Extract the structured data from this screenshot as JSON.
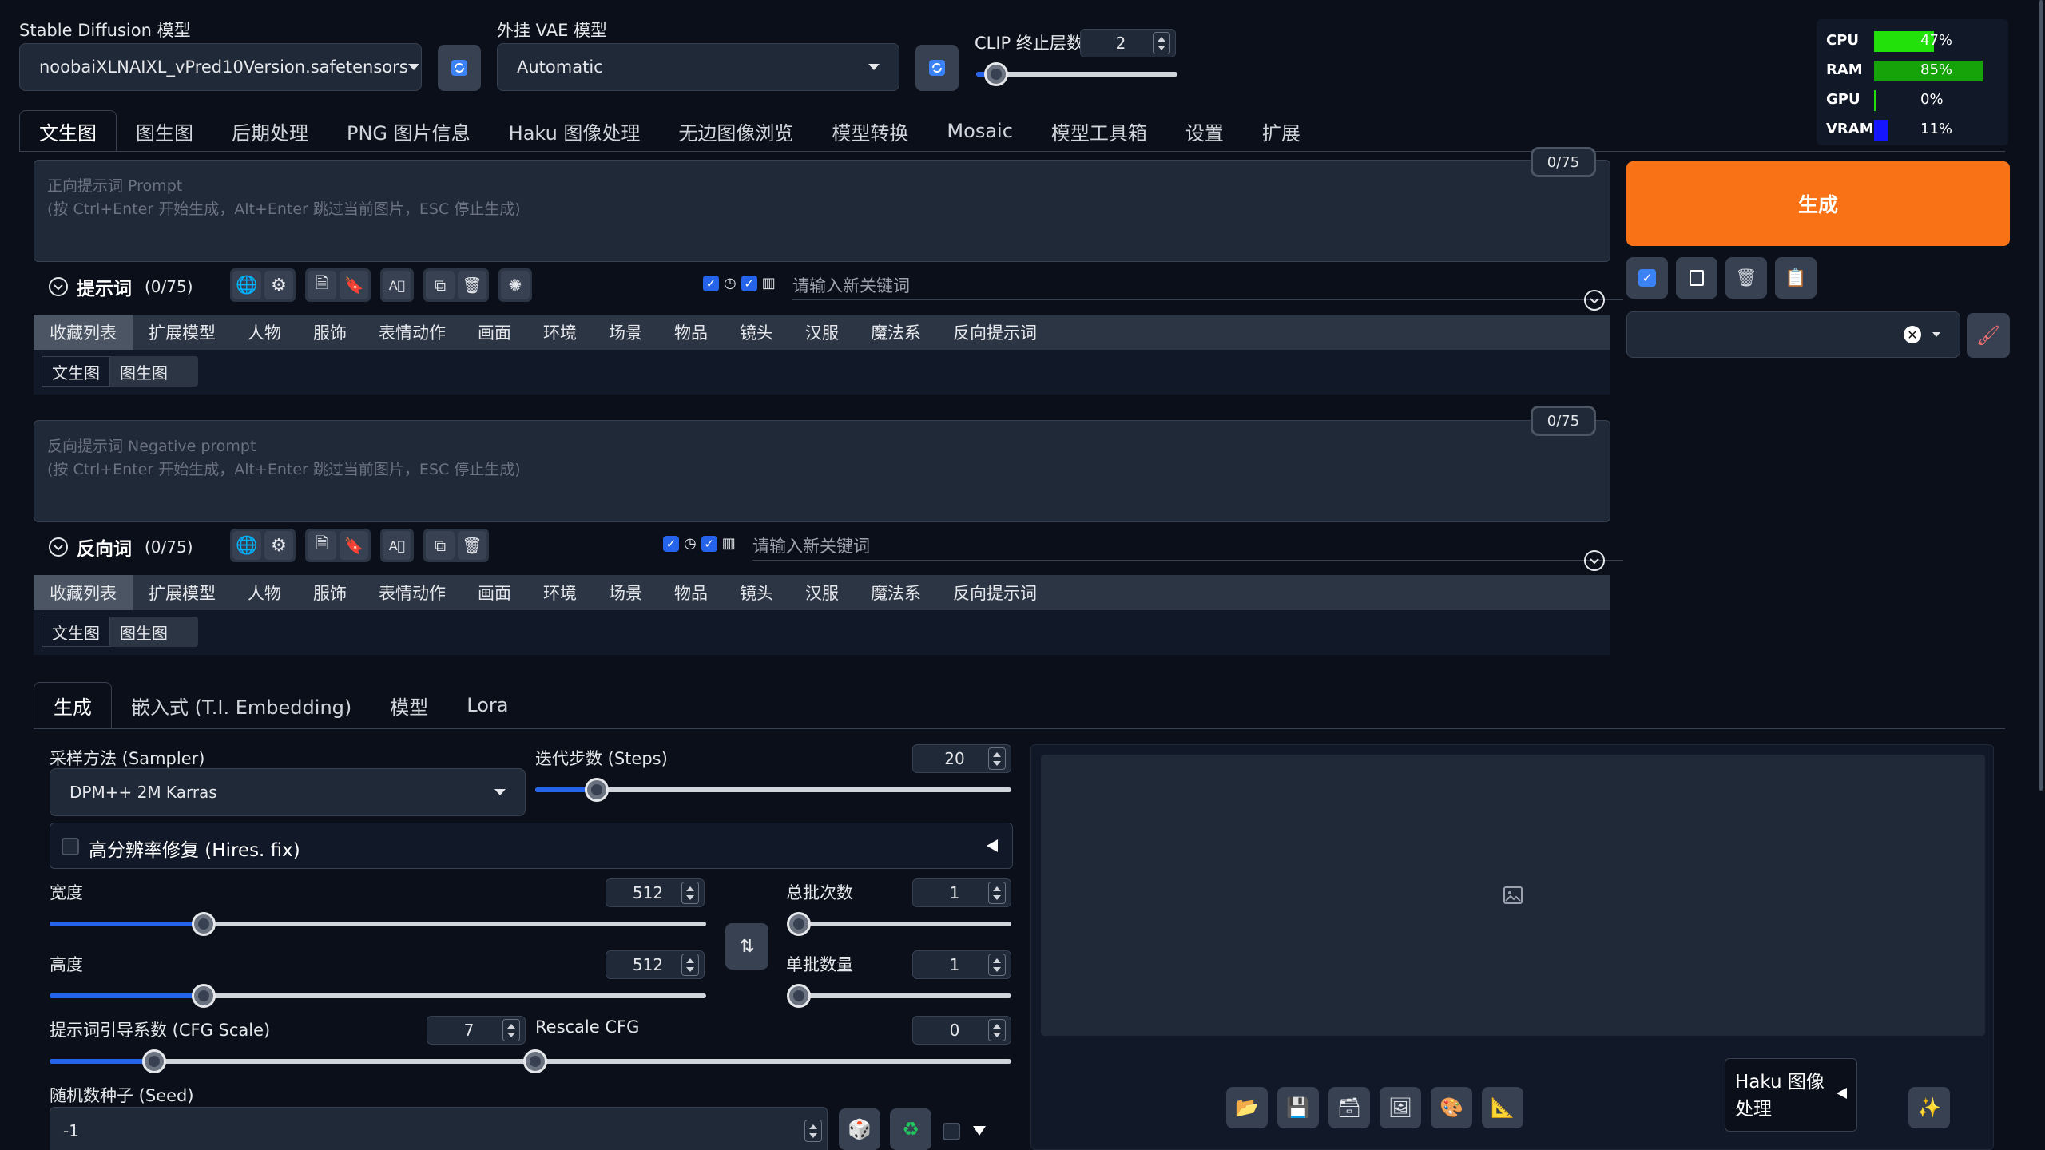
{
  "top": {
    "sd_model_label": "Stable Diffusion 模型",
    "sd_model_value": "noobaiXLNAIXL_vPred10Version.safetensors",
    "vae_label": "外挂 VAE 模型",
    "vae_value": "Automatic",
    "clip_label": "CLIP 终止层数",
    "clip_value": "2",
    "clip_fraction": 0.1
  },
  "monitor": [
    {
      "name": "CPU",
      "value": "47%",
      "fraction": 0.47,
      "color": "#22e00a"
    },
    {
      "name": "RAM",
      "value": "85%",
      "fraction": 0.85,
      "color": "#16a30a"
    },
    {
      "name": "GPU",
      "value": "0%",
      "fraction": 0.0,
      "color": "#22e00a"
    },
    {
      "name": "VRAM",
      "value": "11%",
      "fraction": 0.11,
      "color": "#1515ff"
    }
  ],
  "main_tabs": [
    "文生图",
    "图生图",
    "后期处理",
    "PNG 图片信息",
    "Haku 图像处理",
    "无边图像浏览",
    "模型转换",
    "Mosaic",
    "模型工具箱",
    "设置",
    "扩展"
  ],
  "prompt": {
    "counter": "0/75",
    "placeholder": "正向提示词 Prompt\n(按 Ctrl+Enter 开始生成，Alt+Enter 跳过当前图片，ESC 停止生成)",
    "title": "提示词",
    "count": "(0/75)",
    "keyword_placeholder": "请输入新关键词"
  },
  "negative": {
    "counter": "0/75",
    "placeholder": "反向提示词 Negative prompt\n(按 Ctrl+Enter 开始生成，Alt+Enter 跳过当前图片，ESC 停止生成)",
    "title": "反向词",
    "count": "(0/75)",
    "keyword_placeholder": "请输入新关键词"
  },
  "categories": [
    "收藏列表",
    "扩展模型",
    "人物",
    "服饰",
    "表情动作",
    "画面",
    "环境",
    "场景",
    "物品",
    "镜头",
    "汉服",
    "魔法系",
    "反向提示词"
  ],
  "sub_tabs": [
    "文生图",
    "图生图"
  ],
  "generate_label": "生成",
  "gen_tabs": [
    "生成",
    "嵌入式 (T.I. Embedding)",
    "模型",
    "Lora"
  ],
  "sampler": {
    "label": "采样方法 (Sampler)",
    "value": "DPM++ 2M Karras"
  },
  "steps": {
    "label": "迭代步数 (Steps)",
    "value": "20",
    "fraction": 0.13
  },
  "hires_label": "高分辨率修复 (Hires. fix)",
  "width": {
    "label": "宽度",
    "value": "512",
    "fraction": 0.235
  },
  "height": {
    "label": "高度",
    "value": "512",
    "fraction": 0.235
  },
  "batch_count": {
    "label": "总批次数",
    "value": "1",
    "fraction": 0.0
  },
  "batch_size": {
    "label": "单批数量",
    "value": "1",
    "fraction": 0.0
  },
  "cfg": {
    "label": "提示词引导系数 (CFG Scale)",
    "value": "7",
    "fraction": 0.22
  },
  "rescale": {
    "label": "Rescale CFG",
    "value": "0",
    "fraction": 0.0
  },
  "seed": {
    "label": "随机数种子 (Seed)",
    "value": "-1"
  },
  "haku_label": "Haku 图像\n处理"
}
